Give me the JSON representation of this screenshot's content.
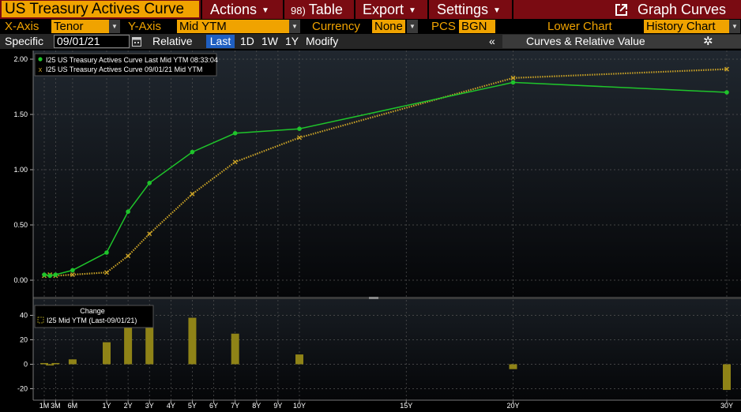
{
  "toolbar": {
    "title": "US Treasury Actives Curve",
    "actions": "Actions",
    "table_prefix": "98)",
    "table": "Table",
    "export": "Export",
    "settings": "Settings",
    "graph_curves": "Graph Curves"
  },
  "axes_bar": {
    "x_axis_label": "X-Axis",
    "x_axis_value": "Tenor",
    "y_axis_label": "Y-Axis",
    "y_axis_value": "Mid YTM",
    "currency_label": "Currency",
    "currency_value": "None",
    "pcs_label": "PCS",
    "pcs_value": "BGN",
    "lower_chart_label": "Lower Chart",
    "lower_chart_value": "History Chart"
  },
  "date_bar": {
    "specific_label": "Specific",
    "date_value": "09/01/21",
    "relative_label": "Relative",
    "last": "Last",
    "d1": "1D",
    "w1": "1W",
    "y1": "1Y",
    "modify": "Modify",
    "collapse": "«",
    "curves_rv": "Curves & Relative Value"
  },
  "colors": {
    "background": "#000000",
    "grid": "#555555",
    "current_curve": "#1fc42b",
    "history_curve": "#c9a227",
    "change_bars": "#8f8317",
    "title_orange": "#f0a300",
    "menu_red": "#7a0b12"
  },
  "chart_data": [
    {
      "type": "line",
      "x_categories": [
        "1M",
        "3M",
        "6M",
        "1Y",
        "2Y",
        "3Y",
        "4Y",
        "5Y",
        "6Y",
        "7Y",
        "8Y",
        "9Y",
        "10Y",
        "15Y",
        "20Y",
        "30Y"
      ],
      "ylim": [
        0,
        2.0
      ],
      "y_ticks": [
        "0.00",
        "0.50",
        "1.00",
        "1.50",
        "2.00"
      ],
      "grid": true,
      "legend": "top-left",
      "series": [
        {
          "name": "I25 US Treasury Actives Curve Last Mid YTM 08:33:04",
          "x": [
            "1M",
            "2M",
            "3M",
            "6M",
            "1Y",
            "2Y",
            "3Y",
            "5Y",
            "7Y",
            "10Y",
            "20Y",
            "30Y"
          ],
          "values": [
            0.05,
            0.04,
            0.05,
            0.09,
            0.25,
            0.62,
            0.88,
            1.16,
            1.33,
            1.37,
            1.79,
            1.7
          ]
        },
        {
          "name": "I25 US Treasury Actives Curve 09/01/21 Mid YTM",
          "x": [
            "1M",
            "2M",
            "3M",
            "6M",
            "1Y",
            "2Y",
            "3Y",
            "5Y",
            "7Y",
            "10Y",
            "20Y",
            "30Y"
          ],
          "values": [
            0.04,
            0.05,
            0.04,
            0.05,
            0.07,
            0.22,
            0.42,
            0.78,
            1.07,
            1.29,
            1.83,
            1.91
          ]
        }
      ]
    },
    {
      "type": "bar",
      "title": "Change",
      "legend": "top-left",
      "ylim": [
        -30,
        50
      ],
      "y_ticks": [
        "-20",
        "0",
        "20",
        "40"
      ],
      "series": [
        {
          "name": "I25 Mid YTM (Last-09/01/21)",
          "x": [
            "1M",
            "2M",
            "3M",
            "6M",
            "1Y",
            "2Y",
            "3Y",
            "5Y",
            "7Y",
            "10Y",
            "20Y",
            "30Y"
          ],
          "values": [
            1,
            -1,
            1,
            4,
            18,
            40,
            46,
            38,
            25,
            8,
            -4,
            -21
          ]
        }
      ]
    }
  ]
}
